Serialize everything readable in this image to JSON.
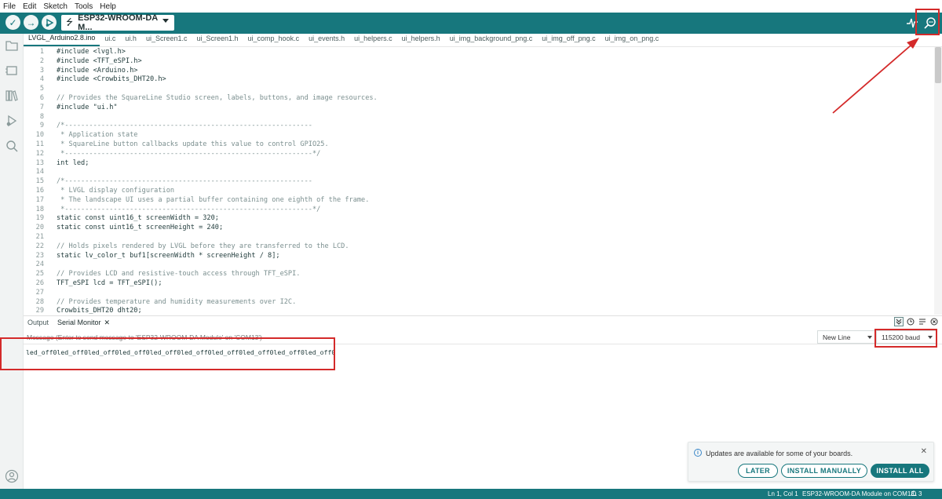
{
  "menu": [
    "File",
    "Edit",
    "Sketch",
    "Tools",
    "Help"
  ],
  "toolbar": {
    "verify_glyph": "✓",
    "upload_glyph": "→",
    "board_name": "ESP32-WROOM-DA M...",
    "usb_glyph": "⭍"
  },
  "tabs": [
    "LVGL_Arduino2.8.ino",
    "ui.c",
    "ui.h",
    "ui_Screen1.c",
    "ui_Screen1.h",
    "ui_comp_hook.c",
    "ui_events.h",
    "ui_helpers.c",
    "ui_helpers.h",
    "ui_img_background_png.c",
    "ui_img_off_png.c",
    "ui_img_on_png.c"
  ],
  "code": [
    {
      "n": "1",
      "t": "#include <lvgl.h>"
    },
    {
      "n": "2",
      "t": "#include <TFT_eSPI.h>"
    },
    {
      "n": "3",
      "t": "#include <Arduino.h>"
    },
    {
      "n": "4",
      "t": "#include <Crowbits_DHT20.h>"
    },
    {
      "n": "5",
      "t": ""
    },
    {
      "n": "6",
      "t": "// Provides the SquareLine Studio screen, labels, buttons, and image resources."
    },
    {
      "n": "7",
      "t": "#include \"ui.h\""
    },
    {
      "n": "8",
      "t": ""
    },
    {
      "n": "9",
      "t": "/*-------------------------------------------------------------"
    },
    {
      "n": "10",
      "t": " * Application state"
    },
    {
      "n": "11",
      "t": " * SquareLine button callbacks update this value to control GPIO25."
    },
    {
      "n": "12",
      "t": " *-------------------------------------------------------------*/"
    },
    {
      "n": "13",
      "t": "int led;"
    },
    {
      "n": "14",
      "t": ""
    },
    {
      "n": "15",
      "t": "/*-------------------------------------------------------------"
    },
    {
      "n": "16",
      "t": " * LVGL display configuration"
    },
    {
      "n": "17",
      "t": " * The landscape UI uses a partial buffer containing one eighth of the frame."
    },
    {
      "n": "18",
      "t": " *-------------------------------------------------------------*/"
    },
    {
      "n": "19",
      "t": "static const uint16_t screenWidth = 320;"
    },
    {
      "n": "20",
      "t": "static const uint16_t screenHeight = 240;"
    },
    {
      "n": "21",
      "t": ""
    },
    {
      "n": "22",
      "t": "// Holds pixels rendered by LVGL before they are transferred to the LCD."
    },
    {
      "n": "23",
      "t": "static lv_color_t buf1[screenWidth * screenHeight / 8];"
    },
    {
      "n": "24",
      "t": ""
    },
    {
      "n": "25",
      "t": "// Provides LCD and resistive-touch access through TFT_eSPI."
    },
    {
      "n": "26",
      "t": "TFT_eSPI lcd = TFT_eSPI();"
    },
    {
      "n": "27",
      "t": ""
    },
    {
      "n": "28",
      "t": "// Provides temperature and humidity measurements over I2C."
    },
    {
      "n": "29",
      "t": "Crowbits_DHT20 dht20;"
    }
  ],
  "panel": {
    "tab_output": "Output",
    "tab_serial": "Serial Monitor",
    "tab_close": "✕",
    "message_placeholder": "Message (Enter to send message to 'ESP32-WROOM-DA Module' on 'COM13')",
    "line_ending": "New Line",
    "baud": "115200 baud",
    "output": "led_off0led_off0led_off0led_off0led_off0led_off0led_off0led_off0led_off0led_off0"
  },
  "notification": {
    "info_glyph": "i",
    "message": "Updates are available for some of your boards.",
    "close_glyph": "✕",
    "later": "LATER",
    "install_manually": "INSTALL MANUALLY",
    "install_all": "INSTALL ALL"
  },
  "status": {
    "cursor": "Ln 1, Col 1",
    "board_port": "ESP32-WROOM-DA Module on COM13",
    "notif_count": "3"
  },
  "colors": {
    "teal": "#17777d",
    "annotation_red": "#d42a2a"
  },
  "icons": {
    "sketchbook": "folder-icon",
    "boards": "board-icon",
    "library": "library-icon",
    "debug": "debug-icon",
    "search": "search-icon",
    "account": "account-icon"
  }
}
